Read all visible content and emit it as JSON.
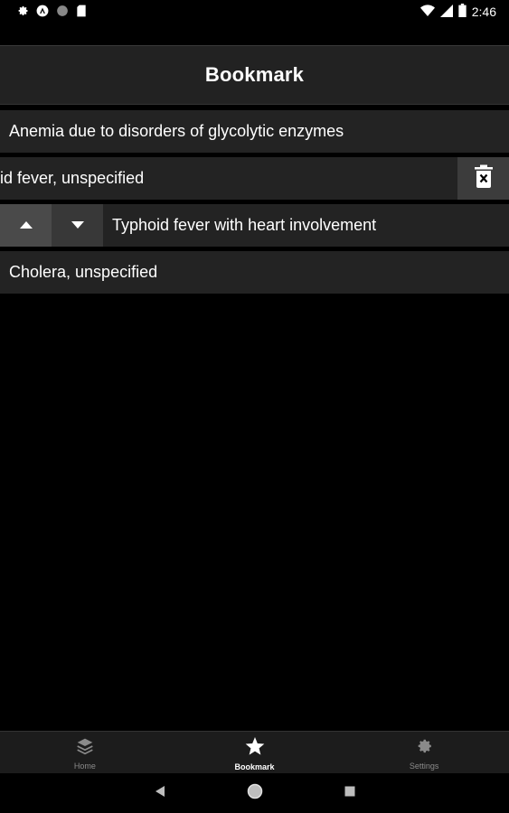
{
  "status_bar": {
    "time": "2:46",
    "left_icons": [
      "gear-icon",
      "app-icon",
      "circle-icon",
      "sd-card-icon"
    ],
    "right_icons": [
      "wifi-icon",
      "signal-icon",
      "battery-icon"
    ]
  },
  "app_bar": {
    "title": "Bookmark"
  },
  "bookmarks": [
    {
      "label": "Anemia due to disorders of glycolytic enzymes"
    },
    {
      "label": "oid fever, unspecified",
      "action_icon": "delete-icon"
    },
    {
      "label": "Typhoid fever with heart involvement",
      "action_icons": [
        "arrow-up-icon",
        "arrow-down-icon"
      ]
    },
    {
      "label": "Cholera, unspecified"
    }
  ],
  "bottom_nav": {
    "items": [
      {
        "label": "Home",
        "icon": "layers-icon",
        "active": false
      },
      {
        "label": "Bookmark",
        "icon": "star-icon",
        "active": true
      },
      {
        "label": "Settings",
        "icon": "gear-icon",
        "active": false
      }
    ]
  },
  "system_nav": {
    "icons": [
      "back-icon",
      "home-icon",
      "recents-icon"
    ]
  },
  "colors": {
    "background": "#000000",
    "surface": "#232323",
    "inactive": "#8a8a8a",
    "text": "#ffffff"
  }
}
